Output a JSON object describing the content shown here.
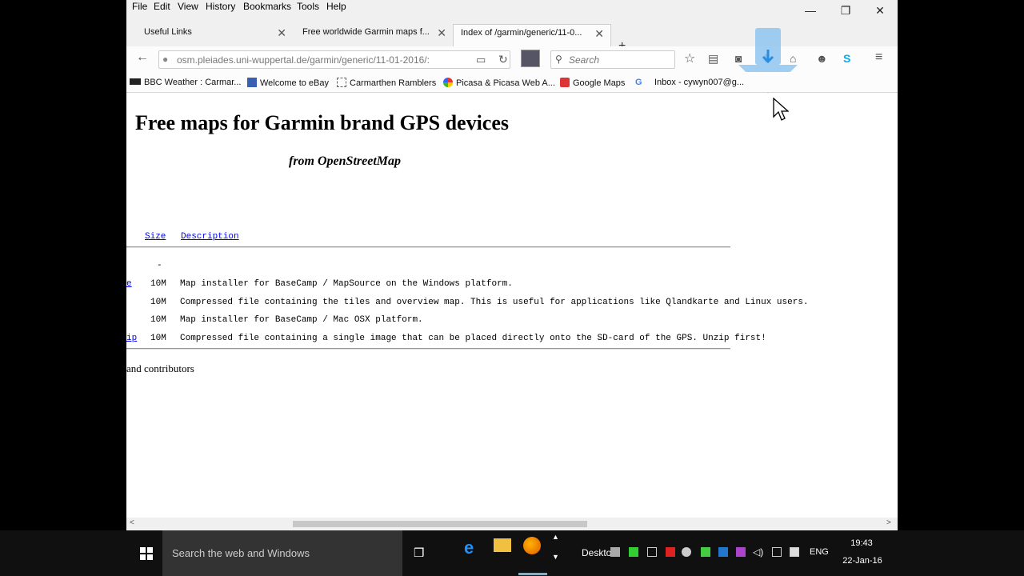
{
  "menu": [
    "File",
    "Edit",
    "View",
    "History",
    "Bookmarks",
    "Tools",
    "Help"
  ],
  "window_controls": {
    "minimize": "—",
    "restore": "❐",
    "close": "✕"
  },
  "tabs": [
    {
      "label": "Useful Links",
      "active": false
    },
    {
      "label": "Free worldwide Garmin maps f...",
      "active": false
    },
    {
      "label": "Index of /garmin/generic/11-0...",
      "active": true
    }
  ],
  "new_tab": "+",
  "navbar": {
    "url": "osm.pleiades.uni-wuppertal.de/garmin/generic/11-01-2016/:",
    "search_placeholder": "Search"
  },
  "bookmarks": [
    "BBC Weather : Carmar...",
    "Welcome to eBay",
    "Carmarthen Ramblers",
    "Picasa & Picasa Web A...",
    "Google Maps",
    "Inbox - cywyn007@g..."
  ],
  "page": {
    "title": "Free maps for Garmin brand GPS devices",
    "subtitle": "from OpenStreetMap",
    "columns": {
      "size": "Size",
      "description": "Description"
    },
    "parent_size": "-",
    "rows": [
      {
        "name": "e",
        "size": "10M",
        "description": "Map installer for BaseCamp / MapSource on the Windows platform."
      },
      {
        "name": "",
        "size": "10M",
        "description": "Compressed file containing the tiles and overview map. This is useful for applications like Qlandkarte and Linux users."
      },
      {
        "name": "",
        "size": "10M",
        "description": "Map installer for BaseCamp / Mac OSX platform."
      },
      {
        "name": "ip",
        "size": "10M",
        "description": "Compressed file containing a single image that can be placed directly onto the SD-card of the GPS. Unzip first!"
      }
    ],
    "footer": "and contributors"
  },
  "taskbar": {
    "search_text": "Search the web and Windows",
    "desktop_label": "Deskto",
    "language": "ENG",
    "time": "19:43",
    "date": "22-Jan-16"
  },
  "colors": {
    "link": "#0000ee",
    "accent_blue": "#2b8de0",
    "download_arrow": "#8fc4f0"
  }
}
